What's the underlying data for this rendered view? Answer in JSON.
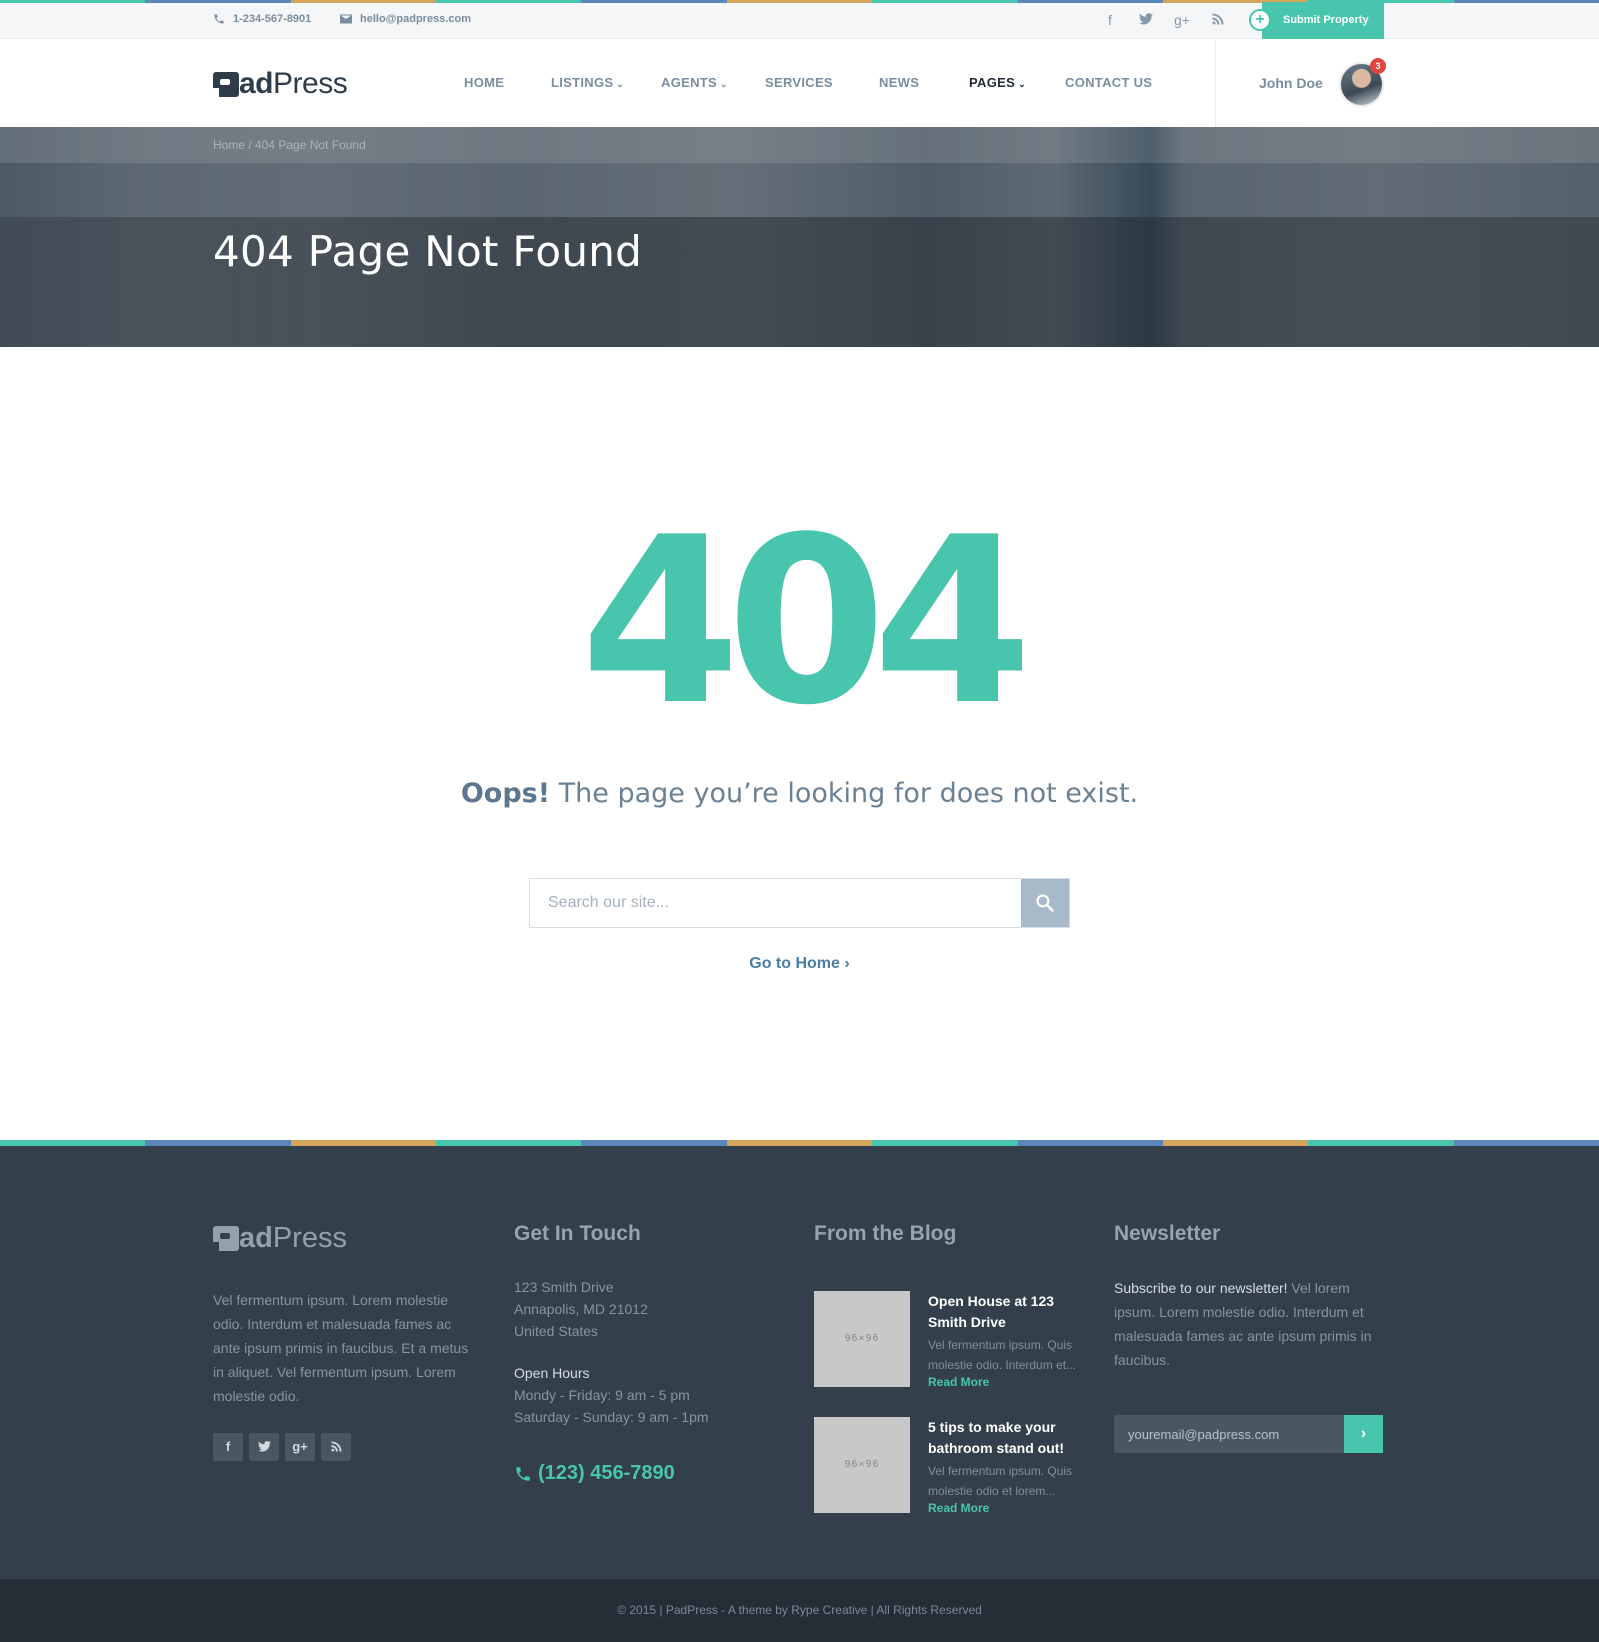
{
  "colors": {
    "accent": "#48c6ad",
    "stripe": [
      "#48c6ad",
      "#5b86b8",
      "#d3a45a"
    ],
    "footer_bg": "#333f4a",
    "bottom_bg": "#252d36"
  },
  "topbar": {
    "phone": "1-234-567-8901",
    "email": "hello@padpress.com",
    "social_icons": [
      "facebook-icon",
      "twitter-icon",
      "google-plus-icon",
      "rss-icon"
    ],
    "social_glyphs": {
      "facebook": "f",
      "twitter": "t",
      "google_plus": "g+",
      "rss": "rss"
    },
    "submit_label": "Submit Property"
  },
  "header": {
    "logo": {
      "bold": "ad",
      "rest": "Press"
    },
    "nav": [
      {
        "label": "HOME",
        "caret": ""
      },
      {
        "label": "LISTINGS",
        "caret": "⌄"
      },
      {
        "label": "AGENTS",
        "caret": "⌄"
      },
      {
        "label": "SERVICES",
        "caret": ""
      },
      {
        "label": "NEWS",
        "caret": ""
      },
      {
        "label": "PAGES",
        "caret": "⌄"
      },
      {
        "label": "CONTACT US",
        "caret": ""
      }
    ],
    "active_nav": "PAGES",
    "user_name": "John Doe",
    "notification_count": "3"
  },
  "hero": {
    "breadcrumb": "Home / 404 Page Not Found",
    "title": "404 Page Not Found"
  },
  "main": {
    "code": "404",
    "oops_bold": "Oops!",
    "oops_rest": " The page you’re looking for does not exist.",
    "search_placeholder": "Search our site...",
    "go_home": "Go to Home"
  },
  "footer": {
    "logo": {
      "bold": "ad",
      "rest": "Press"
    },
    "about": "Vel fermentum ipsum. Lorem molestie odio. Interdum et malesuada fames ac ante ipsum primis in faucibus. Et a metus in aliquet. Vel fermentum ipsum. Lorem molestie odio.",
    "social": [
      "f",
      "t",
      "g+",
      "rss"
    ],
    "contact": {
      "heading": "Get In Touch",
      "address": [
        "123 Smith Drive",
        "Annapolis, MD 21012",
        "United States"
      ],
      "hours_heading": "Open Hours",
      "hours": [
        "Mondy - Friday: 9 am - 5 pm",
        "Saturday - Sunday: 9 am - 1pm"
      ],
      "phone": "(123) 456-7890"
    },
    "blog": {
      "heading": "From the Blog",
      "posts": [
        {
          "thumb": "96×96",
          "title": "Open House at 123 Smith Drive",
          "excerpt": "Vel fermentum ipsum. Quis molestie odio. Interdum et...",
          "more": "Read More"
        },
        {
          "thumb": "96×96",
          "title": "5 tips to make your bathroom stand out!",
          "excerpt": "Vel fermentum ipsum. Quis molestie odio et lorem...",
          "more": "Read More"
        }
      ]
    },
    "newsletter": {
      "heading": "Newsletter",
      "lead_bold": "Subscribe to our newsletter!",
      "lead_rest": " Vel lorem ipsum. Lorem molestie odio. Interdum et malesuada fames ac ante ipsum primis in faucibus.",
      "placeholder": "youremail@padpress.com",
      "submit": "›"
    }
  },
  "bottom": {
    "copyright": "© 2015  |  PadPress - A theme by Rype Creative  |  All Rights Reserved"
  }
}
